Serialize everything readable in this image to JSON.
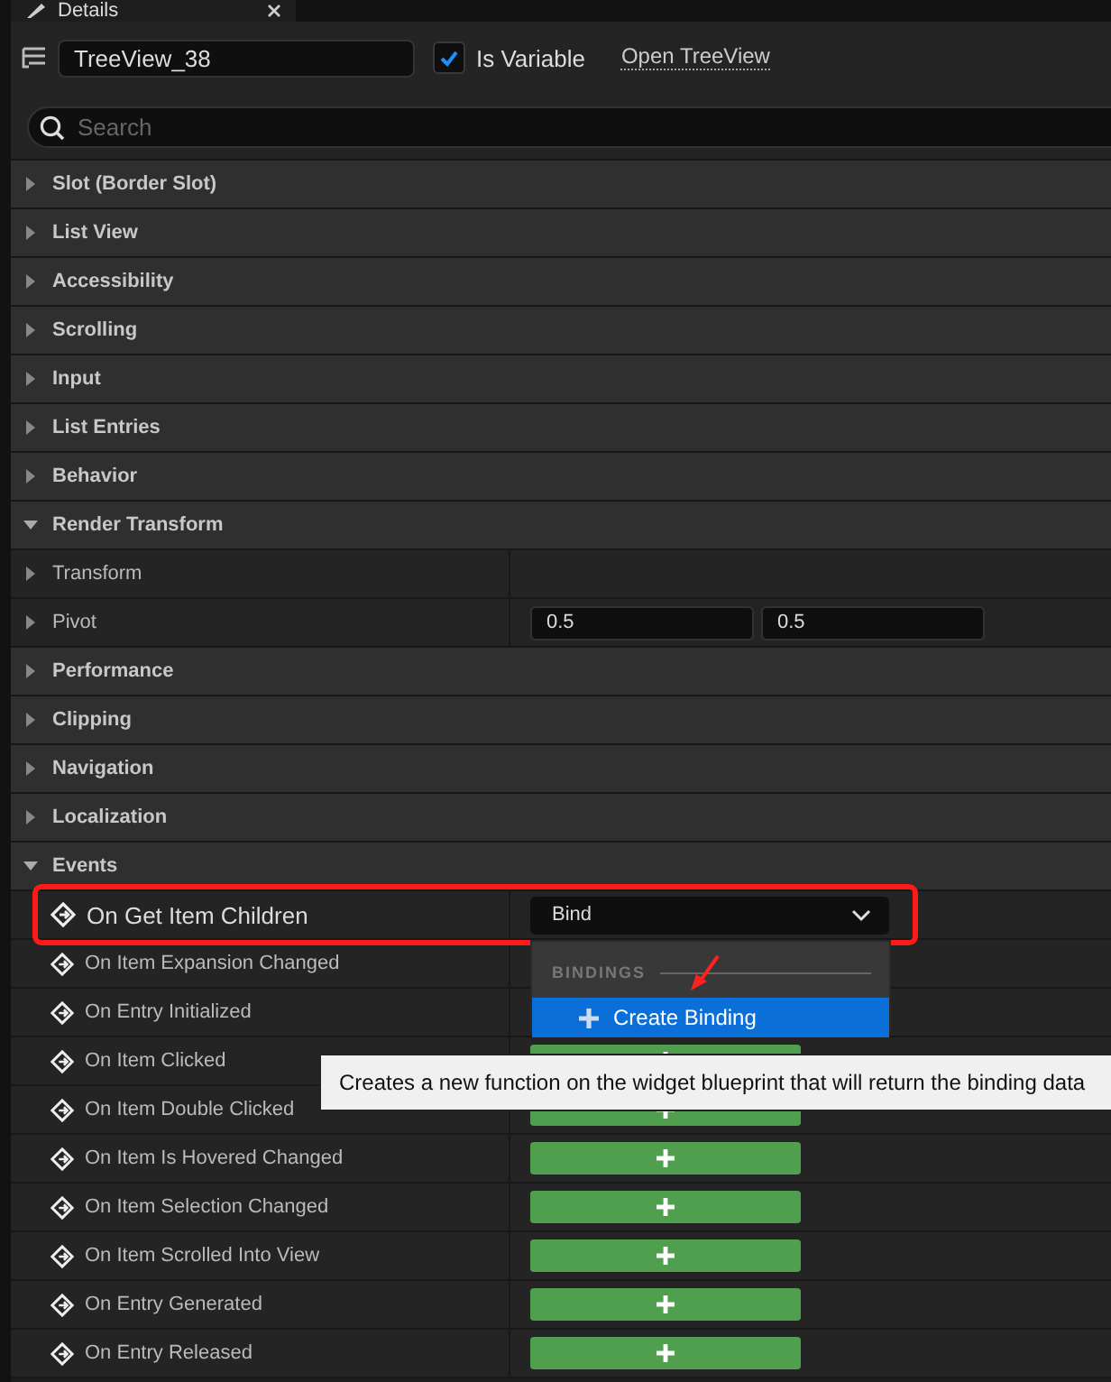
{
  "tab": {
    "title": "Details"
  },
  "toolbar": {
    "name_value": "TreeView_38",
    "is_variable": {
      "label": "Is Variable",
      "checked": true
    },
    "open_link": "Open TreeView"
  },
  "search": {
    "placeholder": "Search"
  },
  "sections": [
    {
      "label": "Slot (Border Slot)",
      "expanded": false
    },
    {
      "label": "List View",
      "expanded": false
    },
    {
      "label": "Accessibility",
      "expanded": false
    },
    {
      "label": "Scrolling",
      "expanded": false
    },
    {
      "label": "Input",
      "expanded": false
    },
    {
      "label": "List Entries",
      "expanded": false
    },
    {
      "label": "Behavior",
      "expanded": false
    },
    {
      "label": "Render Transform",
      "expanded": true,
      "children": [
        {
          "kind": "property",
          "label": "Transform",
          "expanded": false
        },
        {
          "kind": "property",
          "label": "Pivot",
          "expanded": false,
          "values": [
            "0.5",
            "0.5"
          ]
        }
      ]
    },
    {
      "label": "Performance",
      "expanded": false
    },
    {
      "label": "Clipping",
      "expanded": false
    },
    {
      "label": "Navigation",
      "expanded": false
    },
    {
      "label": "Localization",
      "expanded": false
    },
    {
      "label": "Events",
      "expanded": true,
      "children": [
        {
          "kind": "bind_event",
          "label": "On Get Item Children",
          "value": "Bind",
          "highlighted": true
        },
        {
          "kind": "plain_event",
          "label": "On Item Expansion Changed"
        },
        {
          "kind": "plain_event",
          "label": "On Entry Initialized"
        },
        {
          "kind": "add_event",
          "label": "On Item Clicked"
        },
        {
          "kind": "add_event",
          "label": "On Item Double Clicked"
        },
        {
          "kind": "add_event",
          "label": "On Item Is Hovered Changed"
        },
        {
          "kind": "add_event",
          "label": "On Item Selection Changed"
        },
        {
          "kind": "add_event",
          "label": "On Item Scrolled Into View"
        },
        {
          "kind": "add_event",
          "label": "On Entry Generated"
        },
        {
          "kind": "add_event",
          "label": "On Entry Released"
        }
      ]
    }
  ],
  "binding_menu": {
    "heading": "BINDINGS",
    "items": [
      {
        "label": "Create Binding",
        "selected": true
      }
    ]
  },
  "tooltip": {
    "text": "Creates a new function on the widget blueprint that will return the binding data"
  }
}
